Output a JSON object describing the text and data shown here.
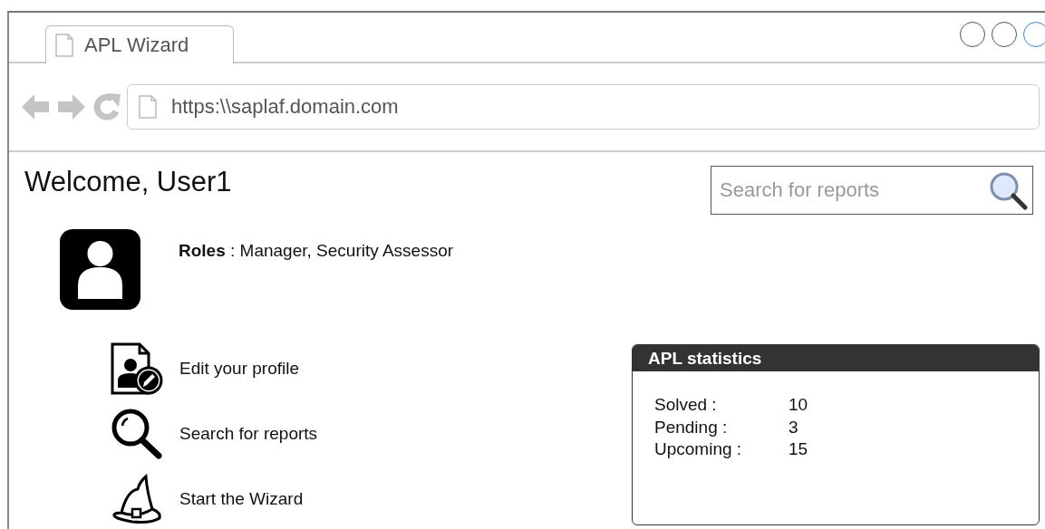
{
  "tab": {
    "label": "APL Wizard",
    "selected": true
  },
  "address_bar": {
    "url": "https:\\\\saplaf.domain.com"
  },
  "welcome": "Welcome, User1",
  "search": {
    "placeholder": "Search for reports"
  },
  "roles": {
    "text": "**Roles** :  Manager, Security Assessor"
  },
  "actions": [
    {
      "kind": "profile",
      "label": "Edit your profile"
    },
    {
      "kind": "search",
      "label": "Search for reports"
    },
    {
      "kind": "wizard",
      "label": "Start the Wizard"
    }
  ],
  "statistics": {
    "title": "APL statistics",
    "rows": [
      {
        "label": "Solved :",
        "value": "10"
      },
      {
        "label": "Pending :",
        "value": "3"
      },
      {
        "label": "Upcoming :",
        "value": "15"
      }
    ]
  }
}
